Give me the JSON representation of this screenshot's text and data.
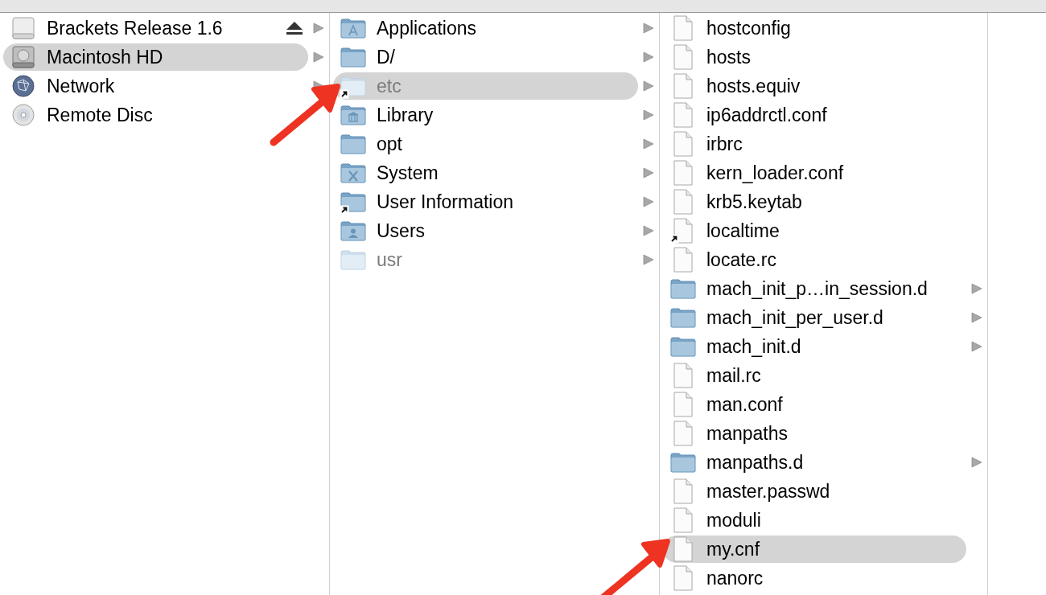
{
  "columns": [
    {
      "items": [
        {
          "name": "Brackets Release 1.6",
          "kind": "removable",
          "eject": true,
          "selected": false,
          "has_children": true
        },
        {
          "name": "Macintosh HD",
          "kind": "harddisk",
          "eject": false,
          "selected": true,
          "has_children": true
        },
        {
          "name": "Network",
          "kind": "network",
          "eject": false,
          "selected": false,
          "has_children": true
        },
        {
          "name": "Remote Disc",
          "kind": "disc",
          "eject": false,
          "selected": false,
          "has_children": false
        }
      ]
    },
    {
      "items": [
        {
          "name": "Applications",
          "kind": "applications",
          "selected": false,
          "has_children": true,
          "alias": false,
          "dimmed": false,
          "pointed": false
        },
        {
          "name": "D/",
          "kind": "folder",
          "selected": false,
          "has_children": true,
          "alias": false,
          "dimmed": false,
          "pointed": false
        },
        {
          "name": "etc",
          "kind": "folder",
          "selected": true,
          "has_children": true,
          "alias": true,
          "dimmed": true,
          "pointed": true
        },
        {
          "name": "Library",
          "kind": "library",
          "selected": false,
          "has_children": true,
          "alias": false,
          "dimmed": false,
          "pointed": false
        },
        {
          "name": "opt",
          "kind": "folder",
          "selected": false,
          "has_children": true,
          "alias": false,
          "dimmed": false,
          "pointed": false
        },
        {
          "name": "System",
          "kind": "system",
          "selected": false,
          "has_children": true,
          "alias": false,
          "dimmed": false,
          "pointed": false
        },
        {
          "name": "User Information",
          "kind": "folder",
          "selected": false,
          "has_children": true,
          "alias": true,
          "dimmed": false,
          "pointed": false
        },
        {
          "name": "Users",
          "kind": "users",
          "selected": false,
          "has_children": true,
          "alias": false,
          "dimmed": false,
          "pointed": false
        },
        {
          "name": "usr",
          "kind": "folder",
          "selected": false,
          "has_children": true,
          "alias": false,
          "dimmed": true,
          "pointed": false
        }
      ]
    },
    {
      "items": [
        {
          "name": "hostconfig",
          "kind": "file",
          "selected": false,
          "has_children": false,
          "alias": false,
          "dimmed": false,
          "pointed": false
        },
        {
          "name": "hosts",
          "kind": "file",
          "selected": false,
          "has_children": false,
          "alias": false,
          "dimmed": false,
          "pointed": false
        },
        {
          "name": "hosts.equiv",
          "kind": "file",
          "selected": false,
          "has_children": false,
          "alias": false,
          "dimmed": false,
          "pointed": false
        },
        {
          "name": "ip6addrctl.conf",
          "kind": "file",
          "selected": false,
          "has_children": false,
          "alias": false,
          "dimmed": false,
          "pointed": false
        },
        {
          "name": "irbrc",
          "kind": "file",
          "selected": false,
          "has_children": false,
          "alias": false,
          "dimmed": false,
          "pointed": false
        },
        {
          "name": "kern_loader.conf",
          "kind": "file",
          "selected": false,
          "has_children": false,
          "alias": false,
          "dimmed": false,
          "pointed": false
        },
        {
          "name": "krb5.keytab",
          "kind": "file",
          "selected": false,
          "has_children": false,
          "alias": false,
          "dimmed": false,
          "pointed": false
        },
        {
          "name": "localtime",
          "kind": "file",
          "selected": false,
          "has_children": false,
          "alias": true,
          "dimmed": false,
          "pointed": false
        },
        {
          "name": "locate.rc",
          "kind": "file",
          "selected": false,
          "has_children": false,
          "alias": false,
          "dimmed": false,
          "pointed": false
        },
        {
          "name": "mach_init_p…in_session.d",
          "kind": "folder",
          "selected": false,
          "has_children": true,
          "alias": false,
          "dimmed": false,
          "pointed": false
        },
        {
          "name": "mach_init_per_user.d",
          "kind": "folder",
          "selected": false,
          "has_children": true,
          "alias": false,
          "dimmed": false,
          "pointed": false
        },
        {
          "name": "mach_init.d",
          "kind": "folder",
          "selected": false,
          "has_children": true,
          "alias": false,
          "dimmed": false,
          "pointed": false
        },
        {
          "name": "mail.rc",
          "kind": "file",
          "selected": false,
          "has_children": false,
          "alias": false,
          "dimmed": false,
          "pointed": false
        },
        {
          "name": "man.conf",
          "kind": "file",
          "selected": false,
          "has_children": false,
          "alias": false,
          "dimmed": false,
          "pointed": false
        },
        {
          "name": "manpaths",
          "kind": "file",
          "selected": false,
          "has_children": false,
          "alias": false,
          "dimmed": false,
          "pointed": false
        },
        {
          "name": "manpaths.d",
          "kind": "folder",
          "selected": false,
          "has_children": true,
          "alias": false,
          "dimmed": false,
          "pointed": false
        },
        {
          "name": "master.passwd",
          "kind": "file",
          "selected": false,
          "has_children": false,
          "alias": false,
          "dimmed": false,
          "pointed": false
        },
        {
          "name": "moduli",
          "kind": "file",
          "selected": false,
          "has_children": false,
          "alias": false,
          "dimmed": false,
          "pointed": false
        },
        {
          "name": "my.cnf",
          "kind": "file",
          "selected": true,
          "has_children": false,
          "alias": false,
          "dimmed": false,
          "pointed": true
        },
        {
          "name": "nanorc",
          "kind": "file",
          "selected": false,
          "has_children": false,
          "alias": false,
          "dimmed": false,
          "pointed": false
        }
      ]
    }
  ]
}
